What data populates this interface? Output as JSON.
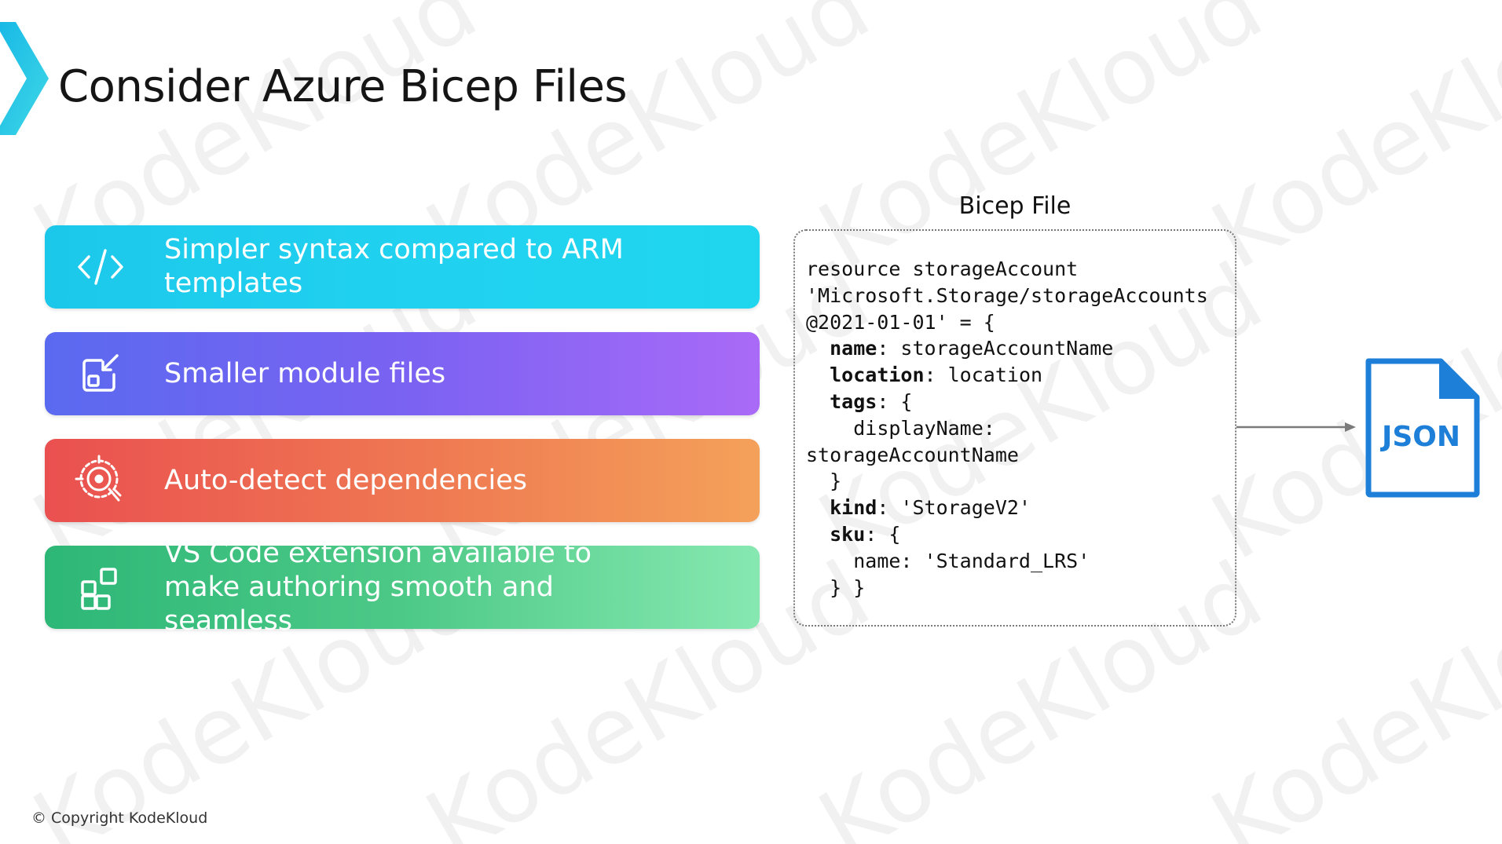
{
  "slide": {
    "title": "Consider Azure Bicep Files",
    "watermark": "KodeKloud",
    "footer": "© Copyright KodeKloud"
  },
  "features": [
    {
      "label": "Simpler syntax compared to ARM templates",
      "icon": "code-brackets-icon"
    },
    {
      "label": "Smaller module files",
      "icon": "module-resize-icon"
    },
    {
      "label": "Auto-detect dependencies",
      "icon": "target-detect-icon"
    },
    {
      "label": "VS Code extension available to make authoring smooth and seamless",
      "icon": "extensions-grid-icon"
    }
  ],
  "code_panel": {
    "heading": "Bicep File",
    "lines": [
      {
        "key": "",
        "text": "resource storageAccount"
      },
      {
        "key": "",
        "text": "'Microsoft.Storage/storageAccounts"
      },
      {
        "key": "",
        "text": "@2021-01-01' = {"
      },
      {
        "indent": "  ",
        "key": "name",
        "text": ": storageAccountName"
      },
      {
        "indent": "  ",
        "key": "location",
        "text": ": location"
      },
      {
        "indent": "  ",
        "key": "tags",
        "text": ": {"
      },
      {
        "indent": "    ",
        "key": "",
        "text": "displayName:"
      },
      {
        "key": "",
        "text": "storageAccountName"
      },
      {
        "indent": "  ",
        "key": "",
        "text": "}"
      },
      {
        "indent": "  ",
        "key": "kind",
        "text": ": 'StorageV2'"
      },
      {
        "indent": "  ",
        "key": "sku",
        "text": ": {"
      },
      {
        "indent": "    ",
        "key": "",
        "text": "name: 'Standard_LRS'"
      },
      {
        "indent": "  ",
        "key": "",
        "text": "} }"
      }
    ]
  },
  "output_file": {
    "label": "JSON",
    "icon": "json-file-icon"
  },
  "colors": {
    "accent_cyan": "#1fcbea",
    "accent_purple": "#7a62f2",
    "accent_orange": "#ef7a52",
    "accent_green": "#4dc987",
    "json_blue": "#1e7fd8"
  }
}
